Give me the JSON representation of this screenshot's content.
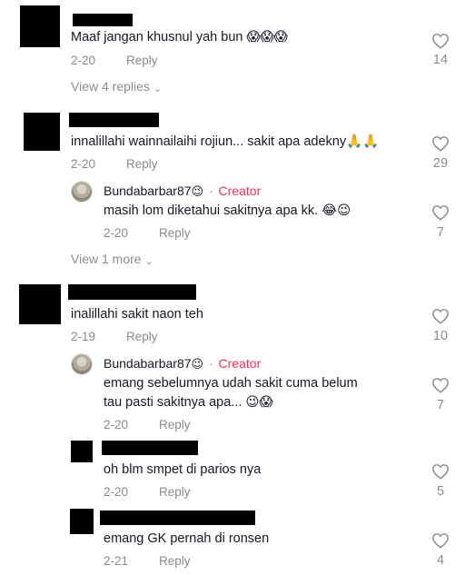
{
  "comments": [
    {
      "text": "Maaf jangan khusnul yah bun 😱😱😱",
      "date": "2-20",
      "reply_label": "Reply",
      "likes": "14",
      "view_replies": "View 4 replies"
    },
    {
      "text": "innalillahi wainnailaihi rojiun... sakit apa adekny🙏🙏",
      "date": "2-20",
      "reply_label": "Reply",
      "likes": "29",
      "replies": [
        {
          "author": "Bundabarbar87",
          "author_emoji": "😉",
          "separator": "·",
          "badge": "Creator",
          "text": "masih lom diketahui sakitnya apa kk. 😂😉",
          "date": "2-20",
          "reply_label": "Reply",
          "likes": "7"
        }
      ],
      "view_more": "View 1 more"
    },
    {
      "text": "inalillahi sakit naon teh",
      "date": "2-19",
      "reply_label": "Reply",
      "likes": "10",
      "replies": [
        {
          "author": "Bundabarbar87",
          "author_emoji": "😉",
          "separator": "·",
          "badge": "Creator",
          "text_line1": "emang sebelumnya udah sakit cuma belum",
          "text_line2": "tau pasti sakitnya apa... 😉😱",
          "date": "2-20",
          "reply_label": "Reply",
          "likes": "7"
        },
        {
          "text": "oh blm smpet di parios nya",
          "date": "2-20",
          "reply_label": "Reply",
          "likes": "5"
        },
        {
          "text": "emang GK pernah di ronsen",
          "date": "2-21",
          "reply_label": "Reply",
          "likes": "4"
        }
      ]
    }
  ],
  "icons": {
    "like": "heart-outline-icon",
    "expand": "chevron-down-icon"
  },
  "colors": {
    "creator": "#fe2c55",
    "meta": "#8a8b91",
    "text": "#161823"
  }
}
